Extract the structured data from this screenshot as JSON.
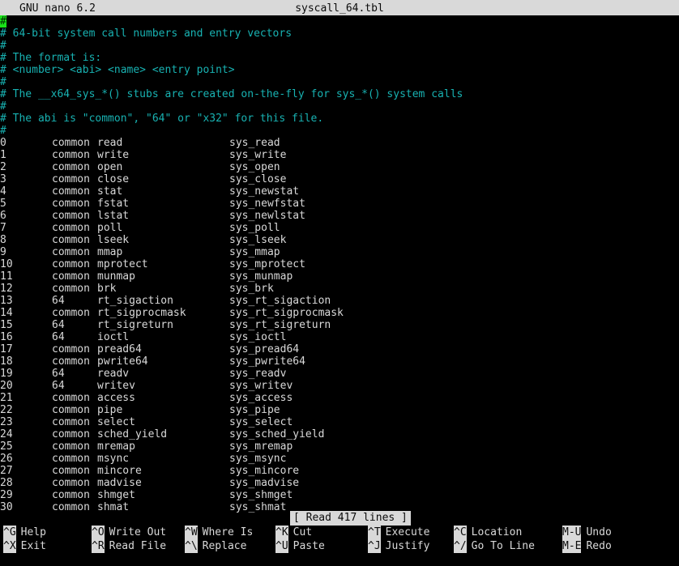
{
  "titlebar": {
    "version": "GNU nano 6.2",
    "filename": "syscall_64.tbl"
  },
  "editor": {
    "cursor_char": "#",
    "header_lines": [
      "",
      "# 64-bit system call numbers and entry vectors",
      "#",
      "# The format is:",
      "# <number> <abi> <name> <entry point>",
      "#",
      "# The __x64_sys_*() stubs are created on-the-fly for sys_*() system calls",
      "#",
      "# The abi is \"common\", \"64\" or \"x32\" for this file.",
      "#"
    ],
    "rows": [
      {
        "number": "0",
        "abi": "common",
        "name": "read",
        "entry": "sys_read"
      },
      {
        "number": "1",
        "abi": "common",
        "name": "write",
        "entry": "sys_write"
      },
      {
        "number": "2",
        "abi": "common",
        "name": "open",
        "entry": "sys_open"
      },
      {
        "number": "3",
        "abi": "common",
        "name": "close",
        "entry": "sys_close"
      },
      {
        "number": "4",
        "abi": "common",
        "name": "stat",
        "entry": "sys_newstat"
      },
      {
        "number": "5",
        "abi": "common",
        "name": "fstat",
        "entry": "sys_newfstat"
      },
      {
        "number": "6",
        "abi": "common",
        "name": "lstat",
        "entry": "sys_newlstat"
      },
      {
        "number": "7",
        "abi": "common",
        "name": "poll",
        "entry": "sys_poll"
      },
      {
        "number": "8",
        "abi": "common",
        "name": "lseek",
        "entry": "sys_lseek"
      },
      {
        "number": "9",
        "abi": "common",
        "name": "mmap",
        "entry": "sys_mmap"
      },
      {
        "number": "10",
        "abi": "common",
        "name": "mprotect",
        "entry": "sys_mprotect"
      },
      {
        "number": "11",
        "abi": "common",
        "name": "munmap",
        "entry": "sys_munmap"
      },
      {
        "number": "12",
        "abi": "common",
        "name": "brk",
        "entry": "sys_brk"
      },
      {
        "number": "13",
        "abi": "64",
        "name": "rt_sigaction",
        "entry": "sys_rt_sigaction"
      },
      {
        "number": "14",
        "abi": "common",
        "name": "rt_sigprocmask",
        "entry": "sys_rt_sigprocmask"
      },
      {
        "number": "15",
        "abi": "64",
        "name": "rt_sigreturn",
        "entry": "sys_rt_sigreturn"
      },
      {
        "number": "16",
        "abi": "64",
        "name": "ioctl",
        "entry": "sys_ioctl"
      },
      {
        "number": "17",
        "abi": "common",
        "name": "pread64",
        "entry": "sys_pread64"
      },
      {
        "number": "18",
        "abi": "common",
        "name": "pwrite64",
        "entry": "sys_pwrite64"
      },
      {
        "number": "19",
        "abi": "64",
        "name": "readv",
        "entry": "sys_readv"
      },
      {
        "number": "20",
        "abi": "64",
        "name": "writev",
        "entry": "sys_writev"
      },
      {
        "number": "21",
        "abi": "common",
        "name": "access",
        "entry": "sys_access"
      },
      {
        "number": "22",
        "abi": "common",
        "name": "pipe",
        "entry": "sys_pipe"
      },
      {
        "number": "23",
        "abi": "common",
        "name": "select",
        "entry": "sys_select"
      },
      {
        "number": "24",
        "abi": "common",
        "name": "sched_yield",
        "entry": "sys_sched_yield"
      },
      {
        "number": "25",
        "abi": "common",
        "name": "mremap",
        "entry": "sys_mremap"
      },
      {
        "number": "26",
        "abi": "common",
        "name": "msync",
        "entry": "sys_msync"
      },
      {
        "number": "27",
        "abi": "common",
        "name": "mincore",
        "entry": "sys_mincore"
      },
      {
        "number": "28",
        "abi": "common",
        "name": "madvise",
        "entry": "sys_madvise"
      },
      {
        "number": "29",
        "abi": "common",
        "name": "shmget",
        "entry": "sys_shmget"
      },
      {
        "number": "30",
        "abi": "common",
        "name": "shmat",
        "entry": "sys_shmat"
      }
    ]
  },
  "status": {
    "message": "[ Read 417 lines ]"
  },
  "helpbar": {
    "row1": [
      {
        "key": "^G",
        "label": "Help"
      },
      {
        "key": "^O",
        "label": "Write Out"
      },
      {
        "key": "^W",
        "label": "Where Is"
      },
      {
        "key": "^K",
        "label": "Cut"
      },
      {
        "key": "^T",
        "label": "Execute"
      },
      {
        "key": "^C",
        "label": "Location"
      },
      {
        "key": "M-U",
        "label": "Undo"
      }
    ],
    "row2": [
      {
        "key": "^X",
        "label": "Exit"
      },
      {
        "key": "^R",
        "label": "Read File"
      },
      {
        "key": "^\\",
        "label": "Replace"
      },
      {
        "key": "^U",
        "label": "Paste"
      },
      {
        "key": "^J",
        "label": "Justify"
      },
      {
        "key": "^/",
        "label": "Go To Line"
      },
      {
        "key": "M-E",
        "label": "Redo"
      }
    ]
  },
  "colors": {
    "background": "#000000",
    "comment": "#18b2b2",
    "text": "#d9d9d9",
    "bar_bg": "#d9d9d9",
    "bar_fg": "#0b0b0b",
    "cursor": "#19e219"
  }
}
